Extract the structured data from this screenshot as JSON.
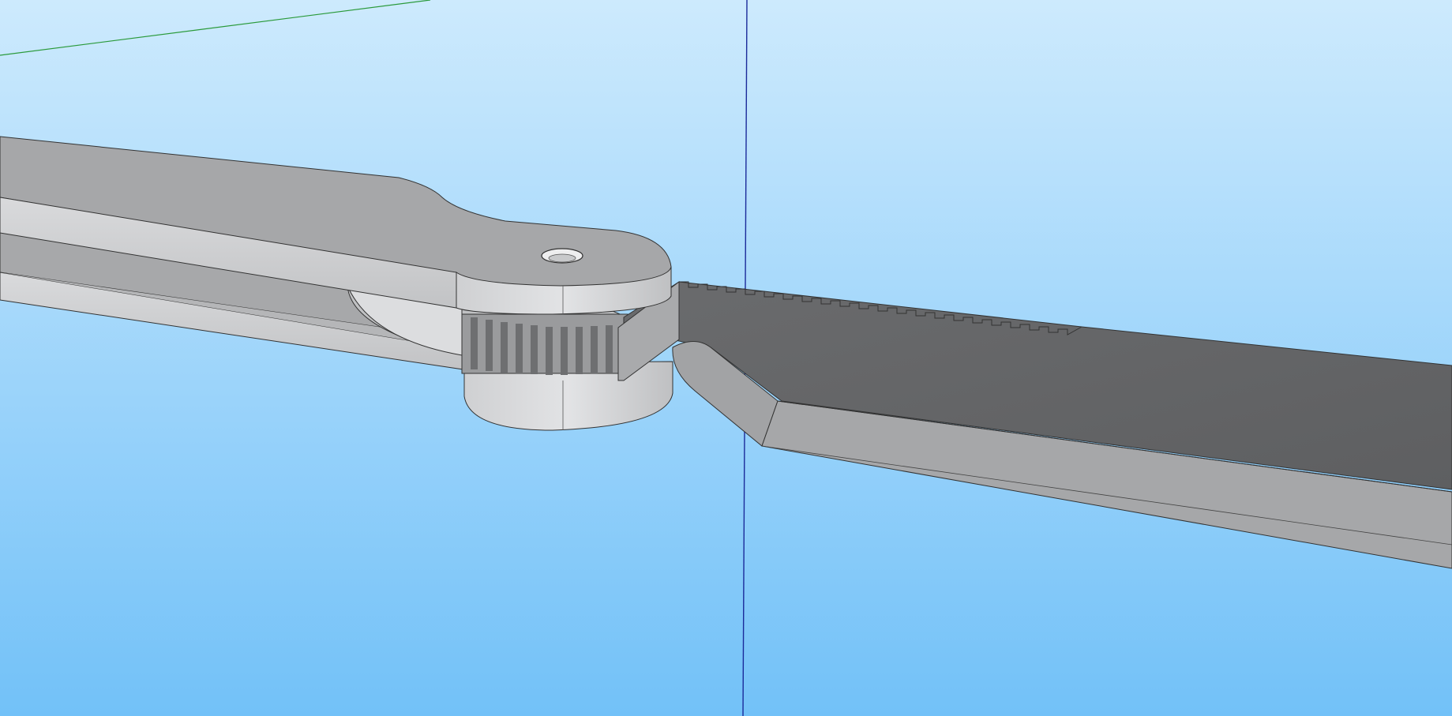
{
  "viewport": {
    "sky_top_color": "#cdeafd",
    "sky_bottom_color": "#72c1f8",
    "axis_colors": {
      "green": "#2a9a3a",
      "blue": "#1b2a9a"
    }
  },
  "model": {
    "parts": [
      {
        "name": "handle-upper-bar",
        "color": "#a8a9ab"
      },
      {
        "name": "handle-lower-bar",
        "color": "#a8a9ab"
      },
      {
        "name": "pivot-hub",
        "color": "#c8c9cb",
        "hole_icon": "pivot-hole-icon"
      },
      {
        "name": "gear-teeth",
        "color": "#8a8b8d"
      },
      {
        "name": "blade",
        "color": "#6c6d6f",
        "edge_color": "#a3a4a6"
      }
    ]
  }
}
